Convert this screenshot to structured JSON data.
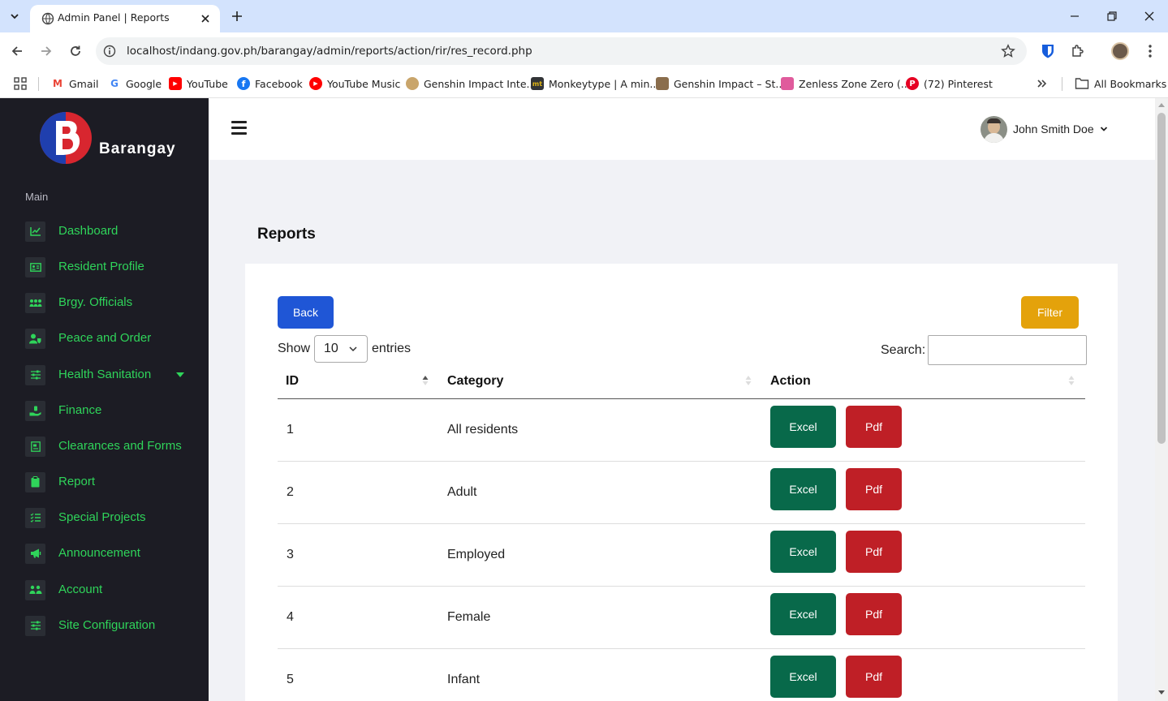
{
  "browser": {
    "tab_title": "Admin Panel | Reports",
    "url": "localhost/indang.gov.ph/barangay/admin/reports/action/rir/res_record.php",
    "bookmarks": [
      {
        "label": "Gmail",
        "icon": "gmail-icon",
        "color": "#ea4335"
      },
      {
        "label": "Google",
        "icon": "google-icon",
        "color": "#4285f4"
      },
      {
        "label": "YouTube",
        "icon": "youtube-icon",
        "color": "#ff0000"
      },
      {
        "label": "Facebook",
        "icon": "facebook-icon",
        "color": "#1877f2"
      },
      {
        "label": "YouTube Music",
        "icon": "youtube-music-icon",
        "color": "#ff0000"
      },
      {
        "label": "Genshin Impact Inte...",
        "icon": "genshin-icon",
        "color": "#c9a56b"
      },
      {
        "label": "Monkeytype | A min...",
        "icon": "monkeytype-icon",
        "color": "#323437"
      },
      {
        "label": "Genshin Impact – St...",
        "icon": "genshin-icon",
        "color": "#8a6d4c"
      },
      {
        "label": "Zenless Zone Zero (...",
        "icon": "zzz-icon",
        "color": "#e05b9c"
      },
      {
        "label": "(72) Pinterest",
        "icon": "pinterest-icon",
        "color": "#e60023"
      }
    ],
    "all_bookmarks": "All Bookmarks"
  },
  "sidebar": {
    "brand": "Barangay",
    "heading": "Main",
    "items": [
      {
        "label": "Dashboard",
        "icon": "chart-line-icon"
      },
      {
        "label": "Resident Profile",
        "icon": "id-card-icon"
      },
      {
        "label": "Brgy. Officials",
        "icon": "users-icon"
      },
      {
        "label": "Peace and Order",
        "icon": "user-shield-icon"
      },
      {
        "label": "Health Sanitation",
        "icon": "sliders-icon"
      },
      {
        "label": "Finance",
        "icon": "hand-money-icon"
      },
      {
        "label": "Clearances and Forms",
        "icon": "file-icon"
      },
      {
        "label": "Report",
        "icon": "clipboard-icon"
      },
      {
        "label": "Special Projects",
        "icon": "list-check-icon"
      },
      {
        "label": "Announcement",
        "icon": "megaphone-icon"
      },
      {
        "label": "Account",
        "icon": "users-cog-icon"
      },
      {
        "label": "Site Configuration",
        "icon": "sliders-icon"
      }
    ]
  },
  "header": {
    "user_name": "John Smith Doe"
  },
  "page": {
    "title": "Reports",
    "back_label": "Back",
    "filter_label": "Filter",
    "show_label": "Show",
    "entries_value": "10",
    "entries_label": "entries",
    "search_label": "Search:",
    "search_value": ""
  },
  "table": {
    "columns": [
      "ID",
      "Category",
      "Action"
    ],
    "excel_label": "Excel",
    "pdf_label": "Pdf",
    "rows": [
      {
        "id": "1",
        "category": "All residents"
      },
      {
        "id": "2",
        "category": "Adult"
      },
      {
        "id": "3",
        "category": "Employed"
      },
      {
        "id": "4",
        "category": "Female"
      },
      {
        "id": "5",
        "category": "Infant"
      }
    ]
  },
  "colors": {
    "sidebar_bg": "#1c1c24",
    "menu_text": "#2fd45a",
    "back": "#1f56d6",
    "filter": "#e4a20b",
    "excel": "#08694a",
    "pdf": "#bf1f26"
  }
}
